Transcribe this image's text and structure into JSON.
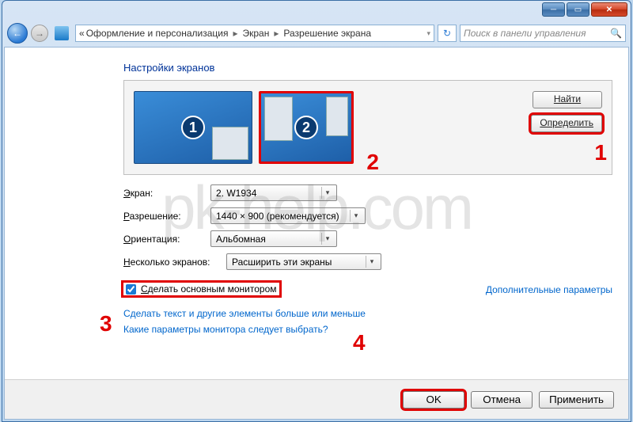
{
  "breadcrumb": {
    "prefix": "«",
    "item1": "Оформление и персонализация",
    "item2": "Экран",
    "item3": "Разрешение экрана"
  },
  "search": {
    "placeholder": "Поиск в панели управления"
  },
  "heading": "Настройки экранов",
  "monitors": {
    "first": "1",
    "second": "2"
  },
  "side_buttons": {
    "find": "Найти",
    "identify": "Определить"
  },
  "annotations": {
    "a1": "1",
    "a2": "2",
    "a3": "3",
    "a4": "4"
  },
  "form": {
    "display_label": "Экран:",
    "display_value": "2. W1934",
    "resolution_label": "Разрешение:",
    "resolution_value": "1440 × 900 (рекомендуется)",
    "orientation_label": "Ориентация:",
    "orientation_value": "Альбомная",
    "multi_label": "Несколько экранов:",
    "multi_value": "Расширить эти экраны"
  },
  "checkbox_label": "Сделать основным монитором",
  "advanced_link": "Дополнительные параметры",
  "links": {
    "text_size": "Сделать текст и другие элементы больше или меньше",
    "which_settings": "Какие параметры монитора следует выбрать?"
  },
  "buttons": {
    "ok": "OK",
    "cancel": "Отмена",
    "apply": "Применить"
  },
  "watermark": "pk-help.com"
}
